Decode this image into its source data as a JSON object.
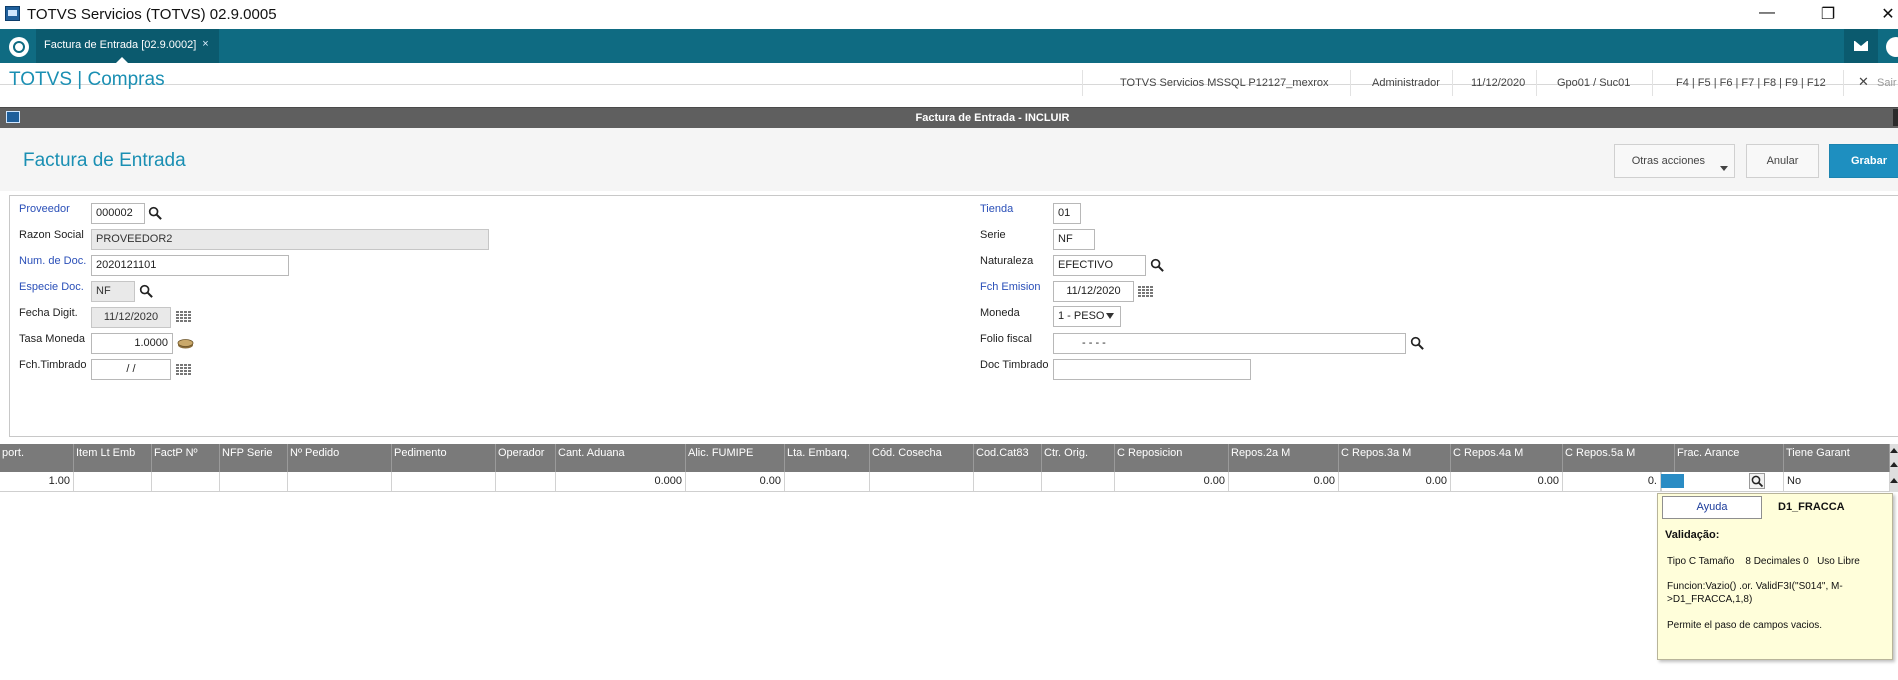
{
  "window": {
    "title": "TOTVS Servicios (TOTVS) 02.9.0005",
    "minimize": "—",
    "restore": "❐",
    "close": "✕"
  },
  "tabbar": {
    "active_tab": "Factura de Entrada [02.9.0002]",
    "close_glyph": "×"
  },
  "app_header": {
    "app_name": "TOTVS | Compras",
    "environment": "TOTVS Servicios MSSQL P12127_mexrox",
    "user": "Administrador",
    "date": "11/12/2020",
    "branch": "Gpo01 / Suc01",
    "shortcuts": "F4 | F5 | F6 | F7 | F8 | F9 | F12",
    "exit_label": "Sair"
  },
  "dialog": {
    "title": "Factura de Entrada - INCLUIR"
  },
  "form_header": {
    "title": "Factura de Entrada",
    "other_actions": "Otras acciones",
    "cancel": "Anular",
    "save": "Grabar"
  },
  "form": {
    "proveedor": {
      "label": "Proveedor",
      "value": "000002"
    },
    "razon_social": {
      "label": "Razon Social",
      "value": "PROVEEDOR2"
    },
    "num_doc": {
      "label": "Num. de Doc.",
      "value": "2020121101"
    },
    "especie_doc": {
      "label": "Especie Doc.",
      "value": "NF"
    },
    "fecha_digit": {
      "label": "Fecha Digit.",
      "value": "11/12/2020"
    },
    "tasa_moneda": {
      "label": "Tasa Moneda",
      "value": "1.0000"
    },
    "fch_timbrado": {
      "label": "Fch.Timbrado",
      "value": "/ /"
    },
    "tienda": {
      "label": "Tienda",
      "value": "01"
    },
    "serie": {
      "label": "Serie",
      "value": "NF"
    },
    "naturaleza": {
      "label": "Naturaleza",
      "value": "EFECTIVO"
    },
    "fch_emision": {
      "label": "Fch Emision",
      "value": "11/12/2020"
    },
    "moneda": {
      "label": "Moneda",
      "value": "1 - PESO"
    },
    "folio_fiscal": {
      "label": "Folio fiscal",
      "value": "-  -  -  -"
    },
    "doc_timbrado": {
      "label": "Doc Timbrado",
      "value": ""
    }
  },
  "grid": {
    "columns": [
      "port.",
      "Item Lt Emb",
      "FactP Nº",
      "NFP Serie",
      "Nº Pedido",
      "Pedimento",
      "Operador",
      "Cant. Aduana",
      "Alic. FUMIPE",
      "Lta. Embarq.",
      "Cód. Cosecha",
      "Cod.Cat83",
      "Ctr. Orig.",
      "C Reposicion",
      "Repos.2a M",
      "C Repos.3a M",
      "C Repos.4a M",
      "C Repos.5a M",
      "Frac. Arance",
      "Tiene Garant"
    ],
    "row": [
      "1.00",
      "",
      "",
      "",
      "",
      "",
      "",
      "0.000",
      "0.00",
      "",
      "",
      "",
      "",
      "0.00",
      "0.00",
      "0.00",
      "0.00",
      "0.",
      "",
      "No"
    ]
  },
  "help_popup": {
    "button": "Ayuda",
    "field": "D1_FRACCA",
    "heading": "Validação:",
    "type_line": "Tipo C Tamaño    8 Decimales 0   Uso Libre",
    "function_line1": "Funcion:Vazio() .or. ValidF3I(\"S014\", M-",
    "function_line2": ">D1_FRACCA,1,8)",
    "note": "Permite el paso de campos vacios."
  },
  "colors": {
    "accent": "#1a8fb3",
    "tabbar": "#0f6b82",
    "save_button": "#1e8fc0",
    "grid_header": "#7a7a7a"
  }
}
